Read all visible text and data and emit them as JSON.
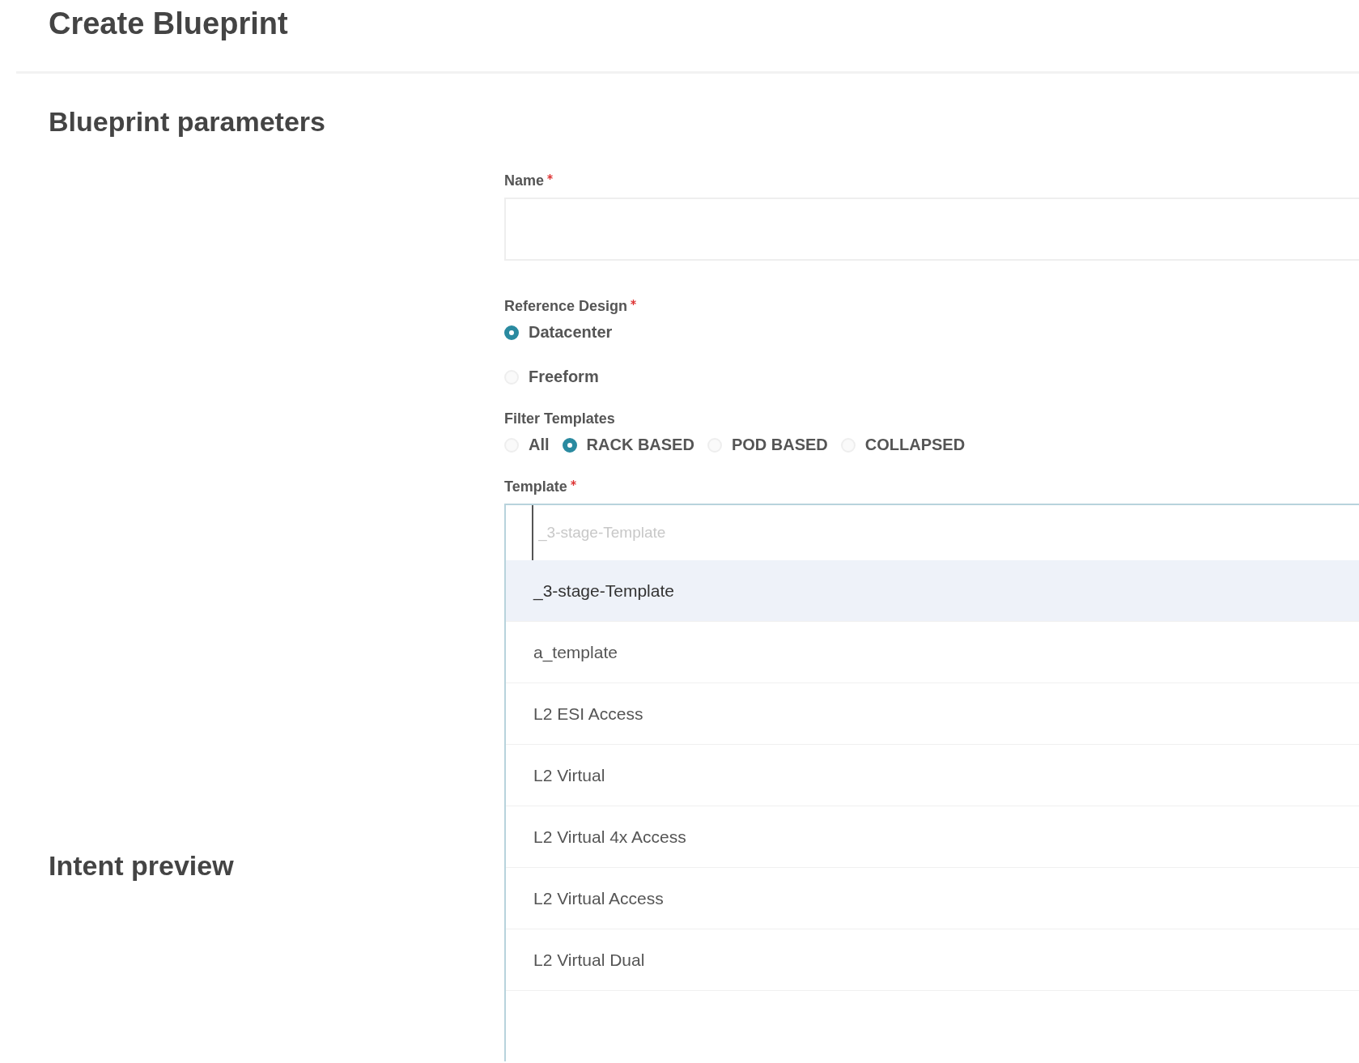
{
  "page": {
    "title": "Create Blueprint"
  },
  "sections": [
    {
      "title": "Blueprint parameters"
    },
    {
      "title": "Intent preview"
    }
  ],
  "name_field": {
    "label": "Name",
    "required": true
  },
  "reference_design": {
    "label": "Reference Design",
    "required": true,
    "options": [
      {
        "label": "Datacenter",
        "selected": true
      },
      {
        "label": "Freeform",
        "selected": false
      }
    ]
  },
  "filter_templates": {
    "label": "Filter Templates",
    "options": [
      {
        "label": "All",
        "selected": false
      },
      {
        "label": "RACK BASED",
        "selected": true
      },
      {
        "label": "POD BASED",
        "selected": false
      },
      {
        "label": "COLLAPSED",
        "selected": false
      }
    ]
  },
  "template": {
    "label": "Template",
    "required": true,
    "placeholder": "_3-stage-Template",
    "options": [
      {
        "label": "_3-stage-Template",
        "selected": true
      },
      {
        "label": "a_template",
        "selected": false
      },
      {
        "label": "L2 ESI Access",
        "selected": false
      },
      {
        "label": "L2 Virtual",
        "selected": false
      },
      {
        "label": "L2 Virtual 4x Access",
        "selected": false
      },
      {
        "label": "L2 Virtual Access",
        "selected": false
      },
      {
        "label": "L2 Virtual Dual",
        "selected": false
      }
    ]
  }
}
